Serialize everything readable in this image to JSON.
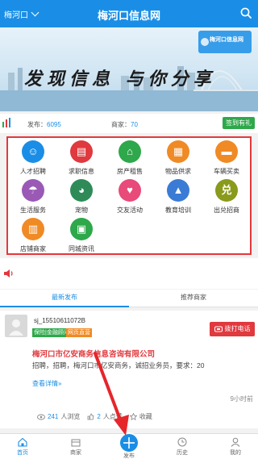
{
  "header": {
    "city": "梅河口",
    "title": "梅河口信息网"
  },
  "banner": {
    "slogan": "发现信息 与你分享",
    "logo_text": "梅河口信息网"
  },
  "stats": {
    "publish_label": "发布：",
    "publish_count": "6095",
    "merchant_label": "商家：",
    "merchant_count": "70",
    "signin_label": "签到有礼"
  },
  "categories": [
    {
      "label": "人才招聘",
      "icon": "person-search-icon",
      "color": "#1a8ee6",
      "glyph": "☺"
    },
    {
      "label": "求职信息",
      "icon": "briefcase-icon",
      "color": "#e0393e",
      "glyph": "▤"
    },
    {
      "label": "房产租售",
      "icon": "house-icon",
      "color": "#2ea84a",
      "glyph": "⌂"
    },
    {
      "label": "物品供求",
      "icon": "cart-icon",
      "color": "#f08a24",
      "glyph": "▦"
    },
    {
      "label": "车辆买卖",
      "icon": "car-icon",
      "color": "#f08a24",
      "glyph": "▬"
    },
    {
      "label": "生活服务",
      "icon": "umbrella-icon",
      "color": "#9b59b6",
      "glyph": "☂"
    },
    {
      "label": "宠物",
      "icon": "dog-icon",
      "color": "#2e8b57",
      "glyph": "◕"
    },
    {
      "label": "交友活动",
      "icon": "heart-icon",
      "color": "#e84a7a",
      "glyph": "♥"
    },
    {
      "label": "教育培训",
      "icon": "graduation-cap-icon",
      "color": "#3a7bd5",
      "glyph": "▲"
    },
    {
      "label": "出兑招商",
      "icon": "exchange-icon",
      "color": "#8a9a1b",
      "glyph": "兑"
    },
    {
      "label": "店铺商家",
      "icon": "store-icon",
      "color": "#f08a24",
      "glyph": "▥"
    },
    {
      "label": "同城资讯",
      "icon": "news-icon",
      "color": "#2ea84a",
      "glyph": "▣"
    }
  ],
  "tabs": {
    "latest": "最新发布",
    "merchants": "推荐商家"
  },
  "post": {
    "username": "sj_15510611072B",
    "badge1": "保险|金融顾问",
    "badge2": "网页直营",
    "call_label": "拨打电话",
    "company": "梅河口市亿安商务信息咨询有限公司",
    "desc": "招聘，招聘，梅河口市亿安商务，诚招业务员，要求：20",
    "more_label": "查看详情»",
    "time": "9小时前",
    "views": "241",
    "views_label": "人浏览",
    "likes": "2",
    "likes_label": "人点赞",
    "fav_label": "收藏"
  },
  "bottom_nav": {
    "home": "首页",
    "merchants": "商家",
    "publish": "发布",
    "history": "历史",
    "mine": "我的"
  },
  "colors": {
    "brand": "#1a8ee6",
    "accent_red": "#e0393e",
    "green": "#2ea84a"
  }
}
